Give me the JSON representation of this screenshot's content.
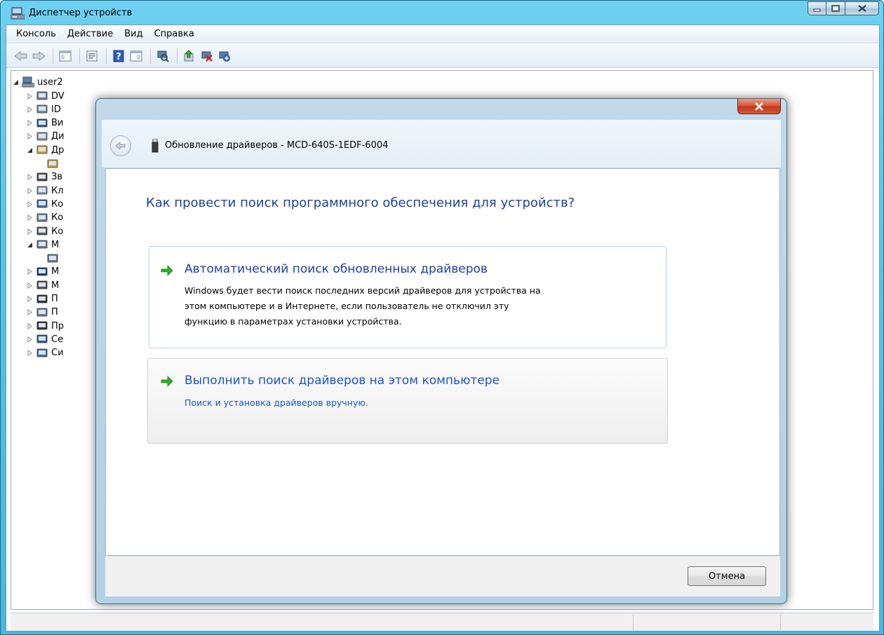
{
  "window": {
    "title": "Диспетчер устройств"
  },
  "menu": [
    "Консоль",
    "Действие",
    "Вид",
    "Справка"
  ],
  "tree": {
    "root_label": "user2",
    "items": [
      "DV",
      "ID",
      "Ви",
      "Ди",
      "Др",
      "",
      "Зв",
      "Кл",
      "Ко",
      "Ко",
      "Ко",
      "М",
      "",
      "М",
      "М",
      "П",
      "П",
      "Пр",
      "Се",
      "Си"
    ]
  },
  "dialog": {
    "title": "Обновление драйверов - MCD-640S-1EDF-6004",
    "question": "Как провести поиск программного обеспечения для устройств?",
    "option_auto": {
      "title": "Автоматический поиск обновленных драйверов",
      "desc_line1": "Windows будет вести поиск последних версий драйверов для устройства на",
      "desc_line2": "этом компьютере и в Интернете, если пользователь не отключил эту",
      "desc_line3": "функцию в параметрах установки устройства."
    },
    "option_manual": {
      "title": "Выполнить поиск драйверов на этом компьютере",
      "desc": "Поиск и установка драйверов вручную."
    },
    "cancel_label": "Отмена"
  },
  "colors": {
    "link_blue": "#1e3f9c",
    "accent_blue": "#1a55c8",
    "arrow_green": "#2db02d",
    "close_red": "#c03a1c"
  }
}
